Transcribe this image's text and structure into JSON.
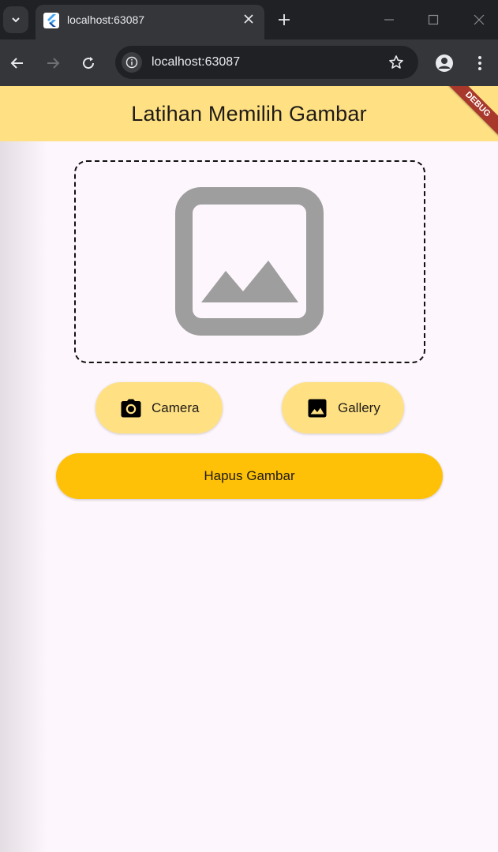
{
  "browser": {
    "tab_title": "localhost:63087",
    "address": "localhost:63087",
    "icons": [
      "tab-search-icon",
      "flutter-favicon-icon",
      "close-icon",
      "new-tab-icon",
      "minimize-icon",
      "maximize-icon",
      "window-close-icon",
      "back-arrow-icon",
      "forward-arrow-icon",
      "reload-icon",
      "info-icon",
      "star-icon",
      "profile-icon",
      "more-vert-icon"
    ]
  },
  "app": {
    "title": "Latihan Memilih Gambar",
    "debug_banner": "DEBUG",
    "colors": {
      "appbar": "#ffe184",
      "background": "#fdf6fc",
      "action_button": "#ffe184",
      "delete_button": "#ffc107",
      "placeholder_icon": "#9e9e9e"
    },
    "image_placeholder_icon": "image-placeholder-icon",
    "buttons": {
      "camera": "Camera",
      "gallery": "Gallery",
      "delete": "Hapus Gambar"
    }
  }
}
